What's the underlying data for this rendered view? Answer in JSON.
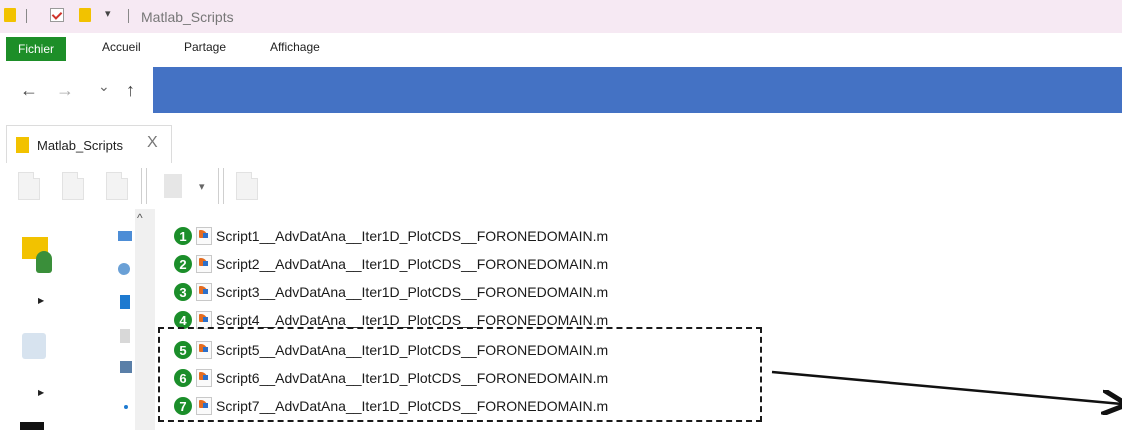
{
  "titlebar": {
    "title": "Matlab_Scripts"
  },
  "ribbon": {
    "tabs": [
      "Fichier",
      "Accueil",
      "Partage",
      "Affichage"
    ]
  },
  "nav": {
    "back_icon": "←",
    "forward_icon": "→",
    "recent_icon": "⌄",
    "up_icon": "↑",
    "address_color": "#4472c4"
  },
  "folder_tab": {
    "label": "Matlab_Scripts",
    "close": "X"
  },
  "files": [
    {
      "num": "1",
      "name": "Script1__AdvDatAna__Iter1D_PlotCDS__FORONEDOMAIN.m"
    },
    {
      "num": "2",
      "name": "Script2__AdvDatAna__Iter1D_PlotCDS__FORONEDOMAIN.m"
    },
    {
      "num": "3",
      "name": "Script3__AdvDatAna__Iter1D_PlotCDS__FORONEDOMAIN.m"
    },
    {
      "num": "4",
      "name": "Script4__AdvDatAna__Iter1D_PlotCDS__FORONEDOMAIN.m"
    },
    {
      "num": "5",
      "name": "Script5__AdvDatAna__Iter1D_PlotCDS__FORONEDOMAIN.m"
    },
    {
      "num": "6",
      "name": "Script6__AdvDatAna__Iter1D_PlotCDS__FORONEDOMAIN.m"
    },
    {
      "num": "7",
      "name": "Script7__AdvDatAna__Iter1D_PlotCDS__FORONEDOMAIN.m"
    }
  ],
  "colors": {
    "badge": "#1b8e2a",
    "file_tab": "#1d8e28",
    "background": "#f6e9f3"
  }
}
